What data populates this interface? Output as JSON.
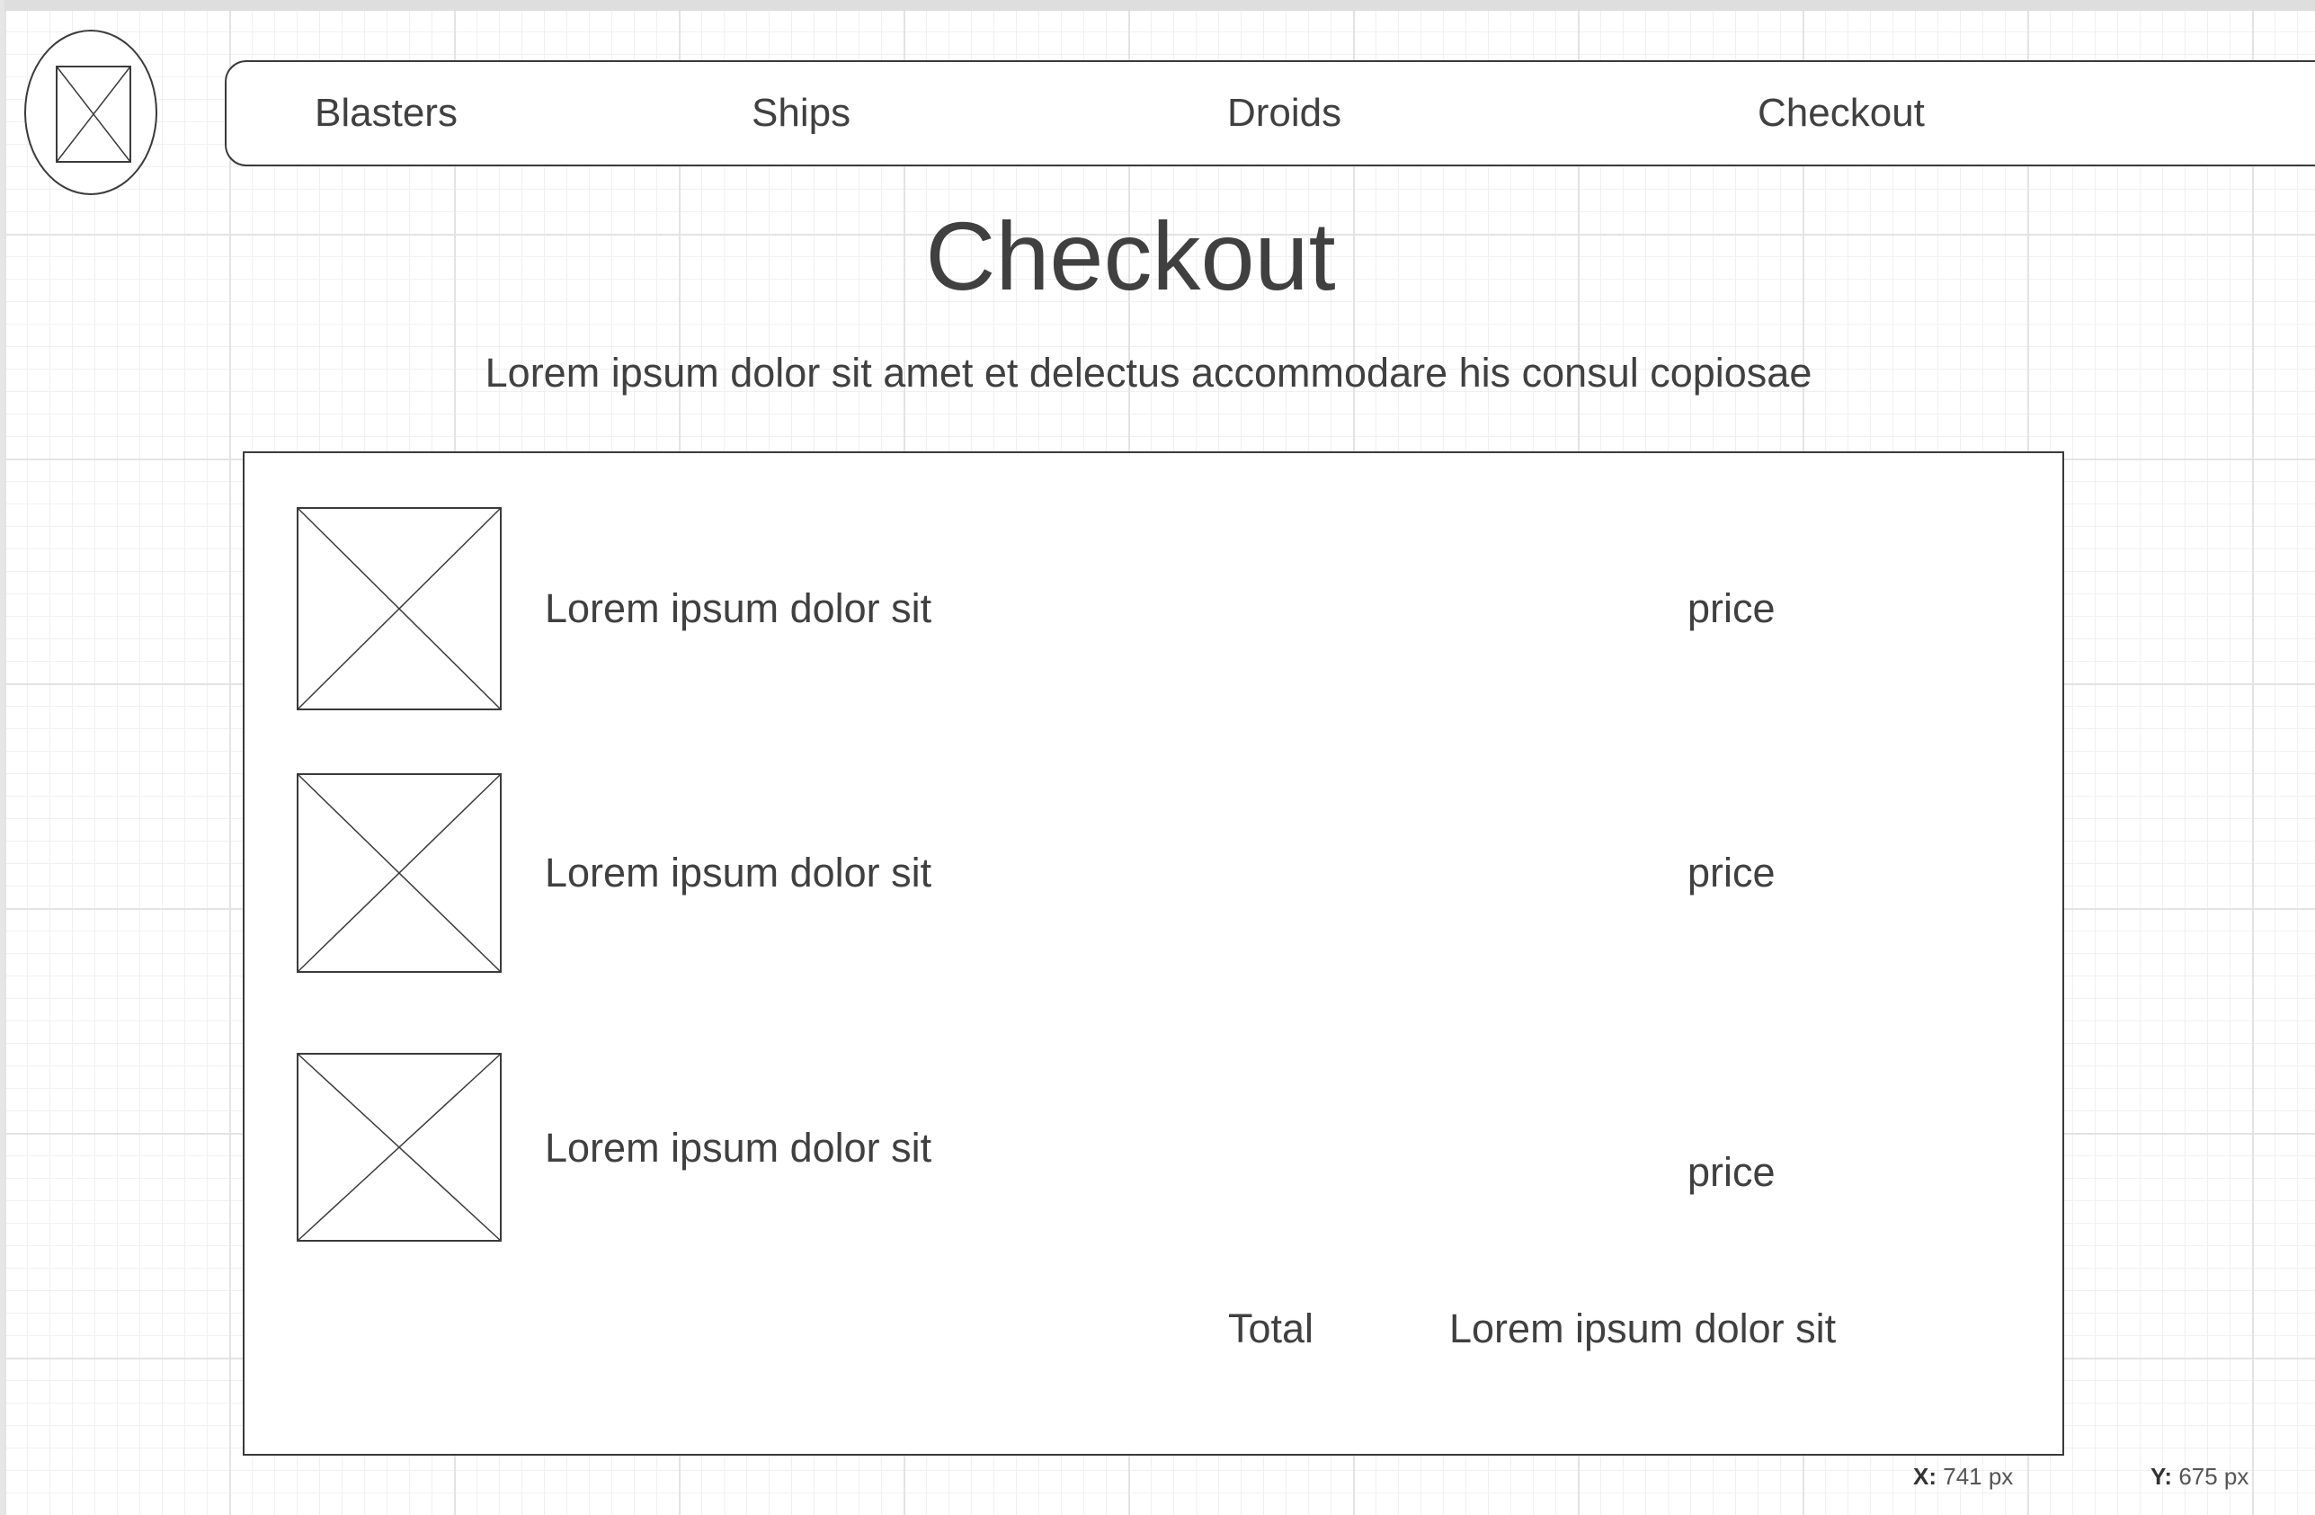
{
  "nav": {
    "items": [
      {
        "label": "Blasters"
      },
      {
        "label": "Ships"
      },
      {
        "label": "Droids"
      },
      {
        "label": "Checkout"
      }
    ]
  },
  "page": {
    "title": "Checkout",
    "subtitle": "Lorem ipsum dolor sit amet et delectus accommodare his consul copiosae"
  },
  "cart": {
    "items": [
      {
        "name": "Lorem ipsum dolor sit",
        "price": "price"
      },
      {
        "name": "Lorem ipsum dolor sit",
        "price": "price"
      },
      {
        "name": "Lorem ipsum dolor sit",
        "price": "price"
      }
    ],
    "total_label": "Total",
    "total_value": "Lorem ipsum dolor sit"
  },
  "status": {
    "x_label": "X:",
    "x_value": "741 px",
    "y_label": "Y:",
    "y_value": "675 px"
  },
  "icons": {
    "logo": "image-placeholder-icon",
    "item_thumbnail": "image-placeholder-icon"
  },
  "colors": {
    "stroke": "#3a3a3a",
    "text": "#404040",
    "grid": "#e3e3e3"
  }
}
